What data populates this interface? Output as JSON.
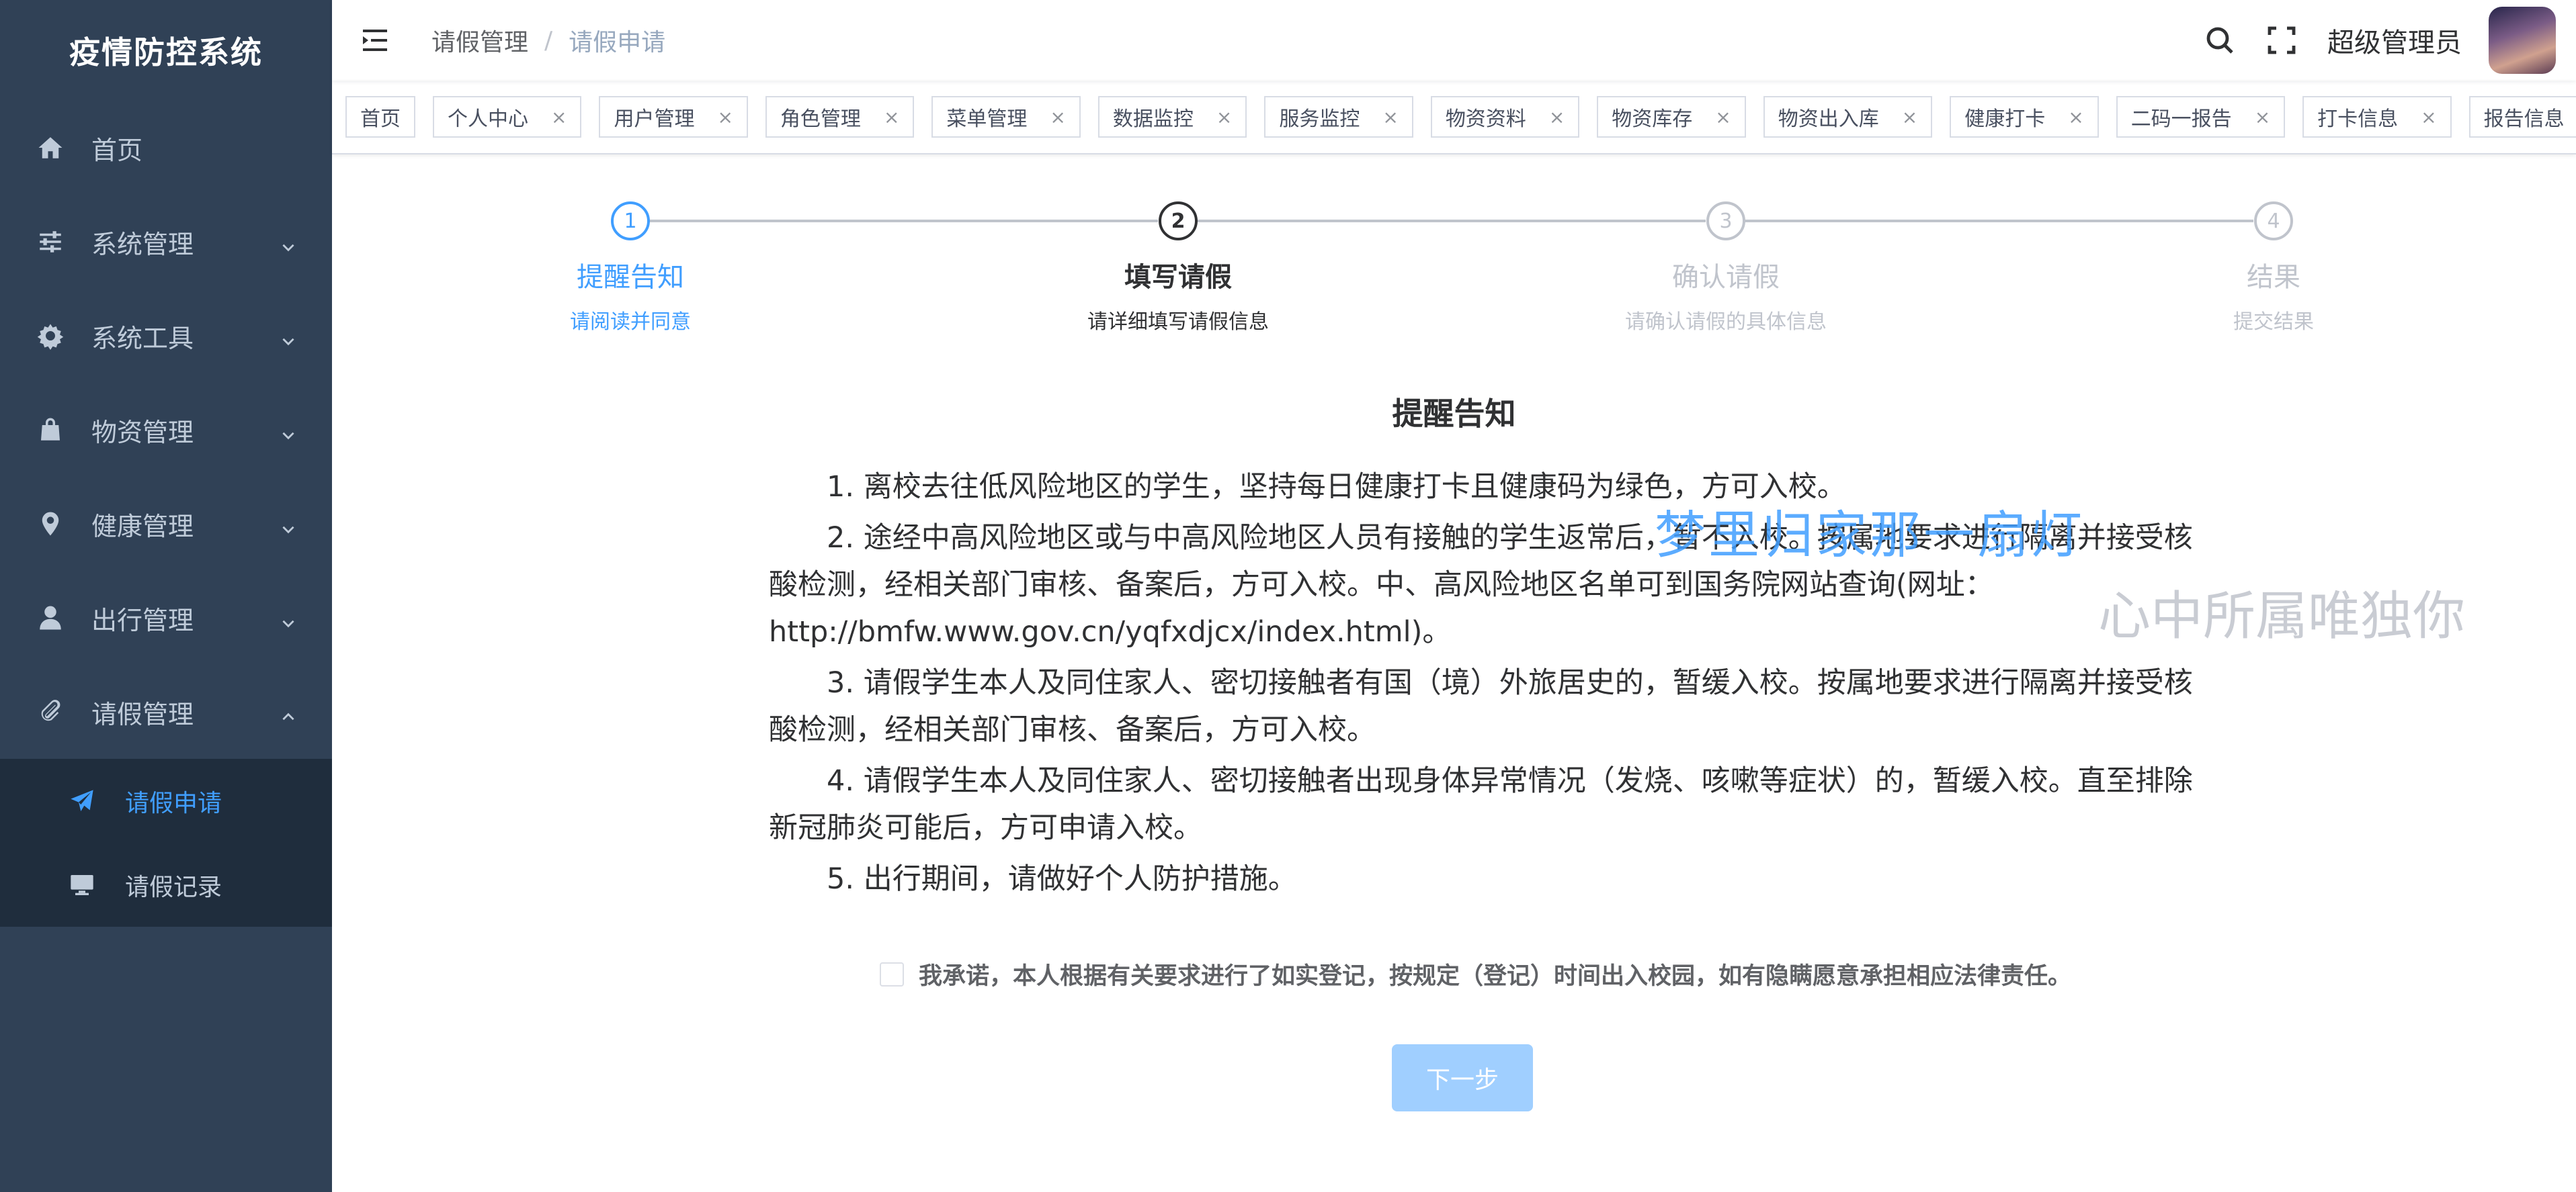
{
  "sidebar": {
    "logo": "疫情防控系统",
    "items": [
      {
        "label": "首页",
        "icon": "home-icon"
      },
      {
        "label": "系统管理",
        "icon": "sliders-icon"
      },
      {
        "label": "系统工具",
        "icon": "gear-icon"
      },
      {
        "label": "物资管理",
        "icon": "bag-icon"
      },
      {
        "label": "健康管理",
        "icon": "location-pin-icon"
      },
      {
        "label": "出行管理",
        "icon": "user-icon"
      },
      {
        "label": "请假管理",
        "icon": "paperclip-icon"
      }
    ],
    "subitems": [
      {
        "label": "请假申请",
        "icon": "send-icon",
        "active": true
      },
      {
        "label": "请假记录",
        "icon": "monitor-icon",
        "active": false
      }
    ]
  },
  "navbar": {
    "breadcrumb": [
      "请假管理",
      "请假申请"
    ],
    "username": "超级管理员"
  },
  "tags": [
    "首页",
    "个人中心",
    "用户管理",
    "角色管理",
    "菜单管理",
    "数据监控",
    "服务监控",
    "物资资料",
    "物资库存",
    "物资出入库",
    "健康打卡",
    "二码一报告",
    "打卡信息",
    "报告信息"
  ],
  "steps": [
    {
      "number": "1",
      "title": "提醒告知",
      "desc": "请阅读并同意",
      "status": "done"
    },
    {
      "number": "2",
      "title": "填写请假",
      "desc": "请详细填写请假信息",
      "status": "current"
    },
    {
      "number": "3",
      "title": "确认请假",
      "desc": "请确认请假的具体信息",
      "status": "wait"
    },
    {
      "number": "4",
      "title": "结果",
      "desc": "提交结果",
      "status": "wait"
    }
  ],
  "notice": {
    "title": "提醒告知",
    "items": [
      "1. 离校去往低风险地区的学生，坚持每日健康打卡且健康码为绿色，方可入校。",
      "2. 途经中高风险地区或与中高风险地区人员有接触的学生返常后，暂不入校。按属地要求进行隔离并接受核酸检测，经相关部门审核、备案后，方可入校。中、高风险地区名单可到国务院网站查询(网址：http://bmfw.www.gov.cn/yqfxdjcx/index.html)。",
      "3. 请假学生本人及同住家人、密切接触者有国（境）外旅居史的，暂缓入校。按属地要求进行隔离并接受核酸检测，经相关部门审核、备案后，方可入校。",
      "4. 请假学生本人及同住家人、密切接触者出现身体异常情况（发烧、咳嗽等症状）的，暂缓入校。直至排除新冠肺炎可能后，方可申请入校。",
      "5. 出行期间，请做好个人防护措施。"
    ]
  },
  "watermark": {
    "line1": "梦里归家那一扇灯",
    "line2": "心中所属唯独你"
  },
  "agreement": {
    "label": "我承诺，本人根据有关要求进行了如实登记，按规定（登记）时间出入校园，如有隐瞒愿意承担相应法律责任。",
    "checked": false
  },
  "next_button": "下一步",
  "colors": {
    "sidebar_bg": "#304156",
    "submenu_bg": "#1f2d3d",
    "accent": "#409eff",
    "button_disabled": "#a0cfff"
  }
}
